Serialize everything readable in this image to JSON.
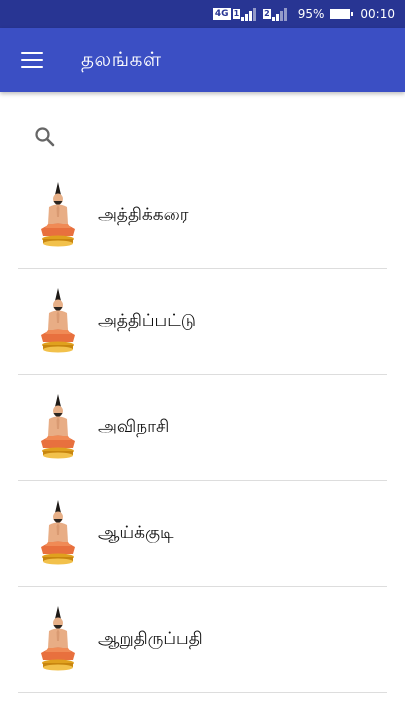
{
  "status_bar": {
    "network": "4G",
    "sim1": "1",
    "sim2": "2",
    "battery": "95%",
    "time": "00:10"
  },
  "app_bar": {
    "title": "தலங்கள்",
    "menu_icon": "hamburger-menu-icon"
  },
  "search": {
    "icon": "search-icon"
  },
  "places": [
    {
      "name": "அத்திக்கரை",
      "icon": "saint-avatar"
    },
    {
      "name": "அத்திப்பட்டு",
      "icon": "saint-avatar"
    },
    {
      "name": "அவிநாசி",
      "icon": "saint-avatar"
    },
    {
      "name": "ஆய்க்குடி",
      "icon": "saint-avatar"
    },
    {
      "name": "ஆறுதிருப்பதி",
      "icon": "saint-avatar"
    }
  ],
  "colors": {
    "status_bar": "#283593",
    "app_bar": "#3b4fc4",
    "divider": "#dddddd"
  }
}
